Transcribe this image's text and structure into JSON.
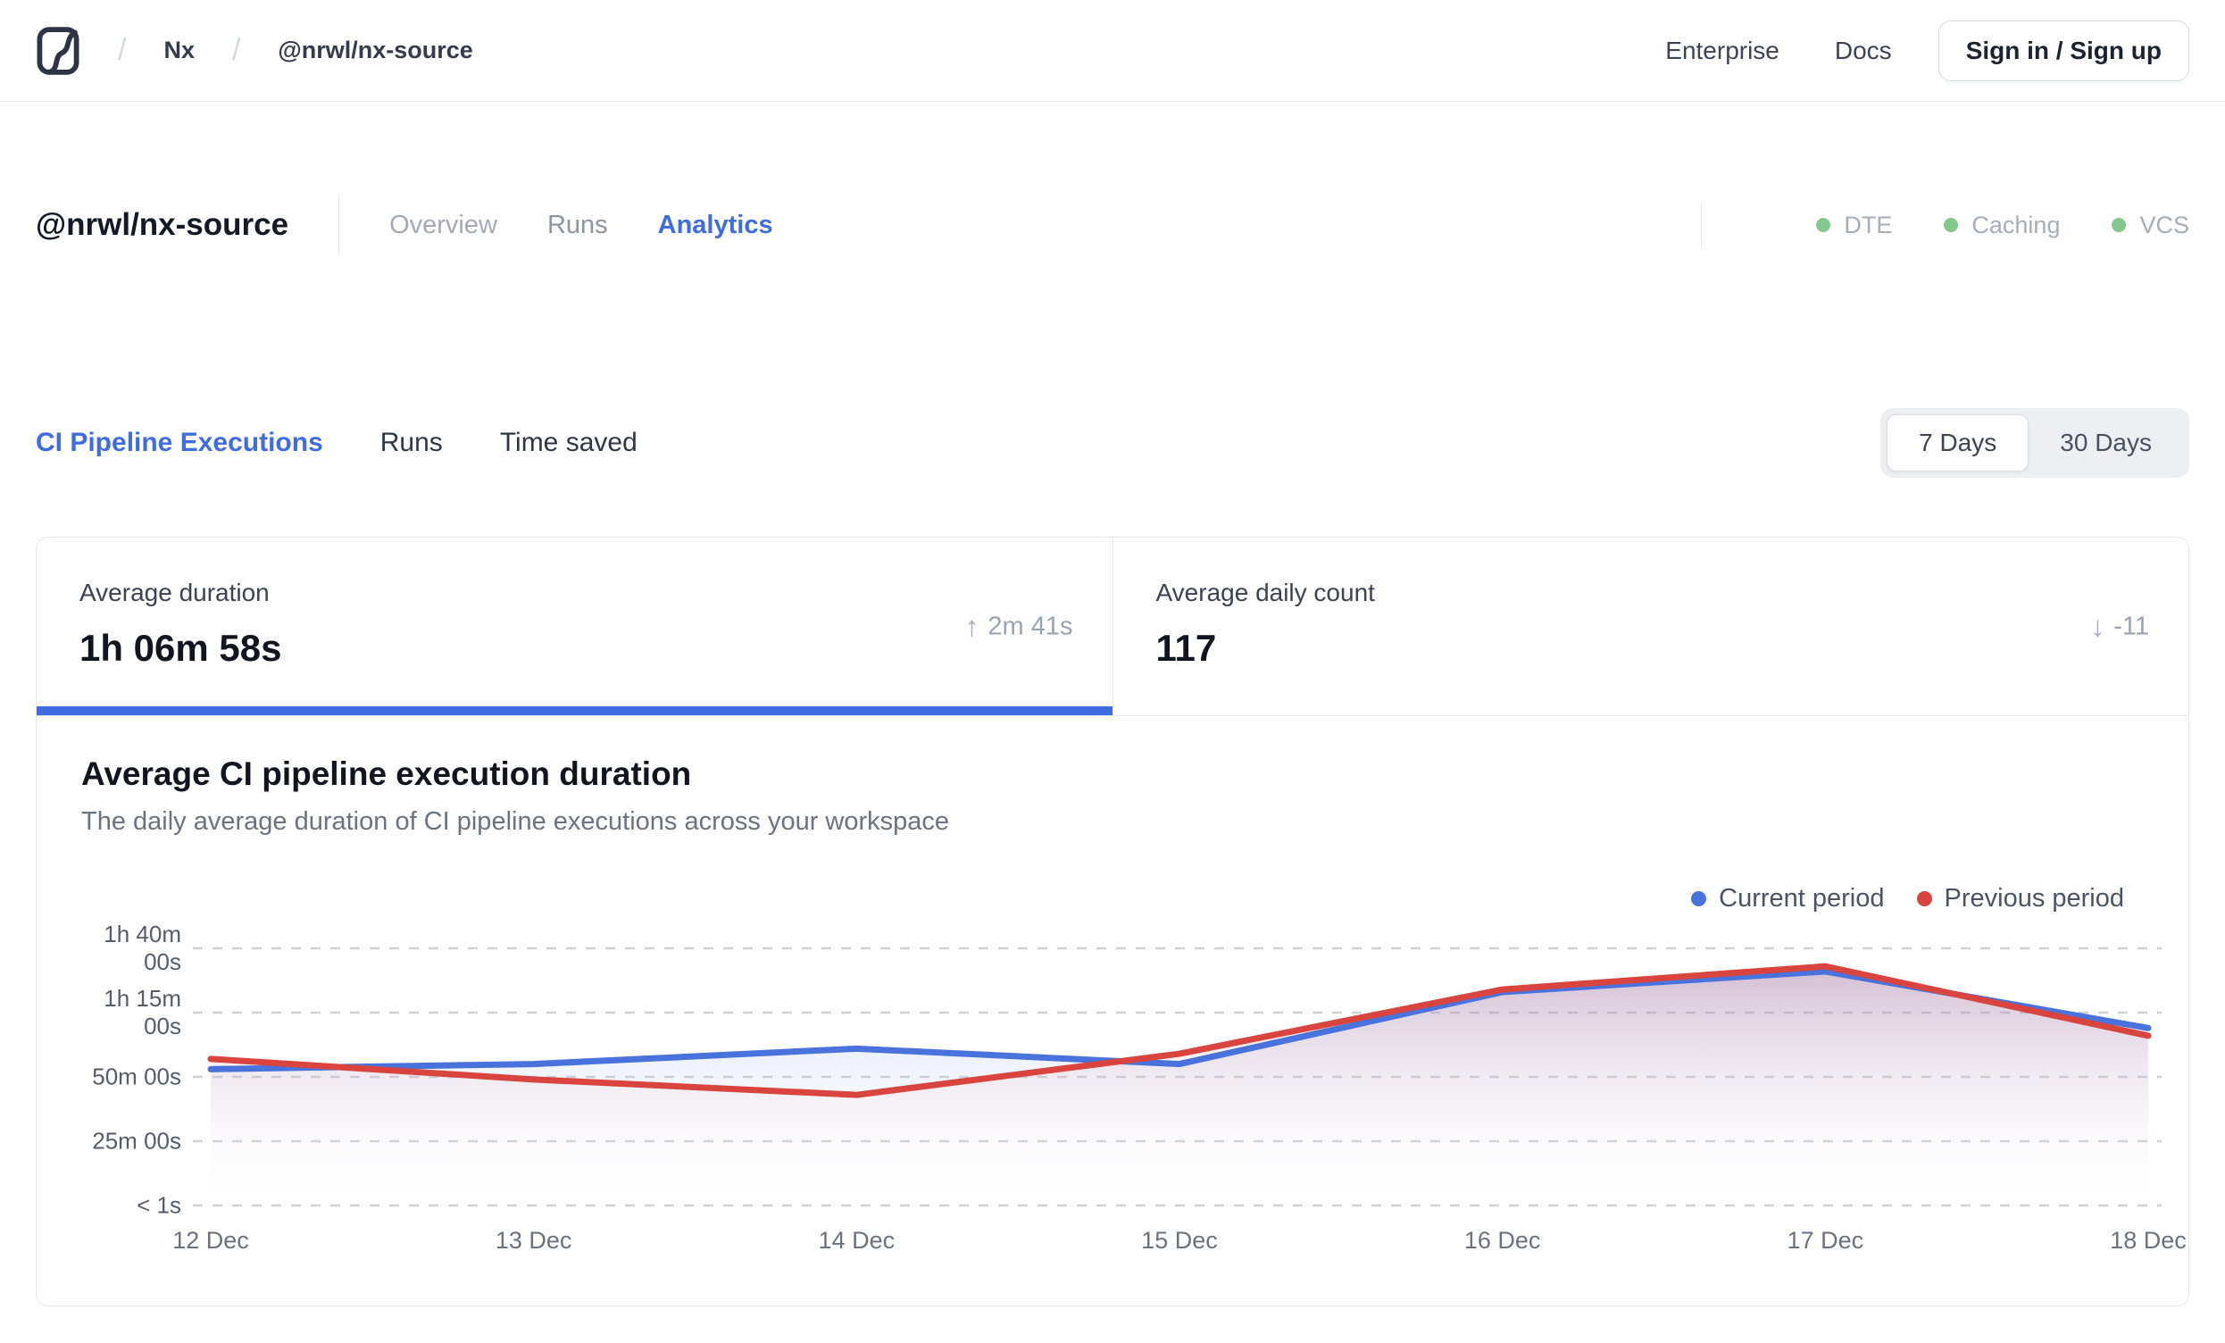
{
  "topbar": {
    "breadcrumb": {
      "separator": "/",
      "root": "Nx",
      "workspace": "@nrwl/nx-source"
    },
    "links": {
      "enterprise": "Enterprise",
      "docs": "Docs"
    },
    "signin_label": "Sign in / Sign up"
  },
  "workspace": {
    "title": "@nrwl/nx-source",
    "tabs": [
      {
        "label": "Overview",
        "active": false
      },
      {
        "label": "Runs",
        "active": false
      },
      {
        "label": "Analytics",
        "active": true
      }
    ],
    "status_badges": [
      {
        "label": "DTE"
      },
      {
        "label": "Caching"
      },
      {
        "label": "VCS"
      }
    ],
    "status_dot_color": "#85c88d"
  },
  "analytics": {
    "tabs": [
      {
        "label": "CI Pipeline Executions",
        "active": true
      },
      {
        "label": "Runs",
        "active": false
      },
      {
        "label": "Time saved",
        "active": false
      }
    ],
    "range_toggle": {
      "options": [
        "7 Days",
        "30 Days"
      ],
      "selected": "7 Days"
    }
  },
  "stats": [
    {
      "label": "Average duration",
      "value": "1h 06m 58s",
      "delta": "2m 41s",
      "direction": "up",
      "selected": true
    },
    {
      "label": "Average daily count",
      "value": "117",
      "delta": "-11",
      "direction": "down",
      "selected": false
    }
  ],
  "chart_data": {
    "type": "area",
    "title": "Average CI pipeline execution duration",
    "subtitle": "The daily average duration of CI pipeline executions across your workspace",
    "categories": [
      "12 Dec",
      "13 Dec",
      "14 Dec",
      "15 Dec",
      "16 Dec",
      "17 Dec",
      "18 Dec"
    ],
    "series": [
      {
        "name": "Current period",
        "color": "#4a72dd",
        "fill_top": "rgba(116,148,228,0.32)",
        "values_minutes": [
          53,
          55,
          61,
          55,
          83,
          91,
          69
        ]
      },
      {
        "name": "Previous period",
        "color": "#d9453e",
        "fill_top": "rgba(216,112,120,0.28)",
        "values_minutes": [
          57,
          49,
          43,
          59,
          84,
          93,
          66
        ]
      }
    ],
    "y_ticks": [
      {
        "label": "1h 40m\n00s",
        "minutes": 100
      },
      {
        "label": "1h 15m\n00s",
        "minutes": 75
      },
      {
        "label": "50m 00s",
        "minutes": 50
      },
      {
        "label": "25m 00s",
        "minutes": 25
      },
      {
        "label": "< 1s",
        "minutes": 0
      }
    ],
    "ylim": [
      0,
      103.5
    ],
    "grid": "horizontal-dashed",
    "grid_color": "#cdd1d8",
    "legend_position": "top-right"
  }
}
